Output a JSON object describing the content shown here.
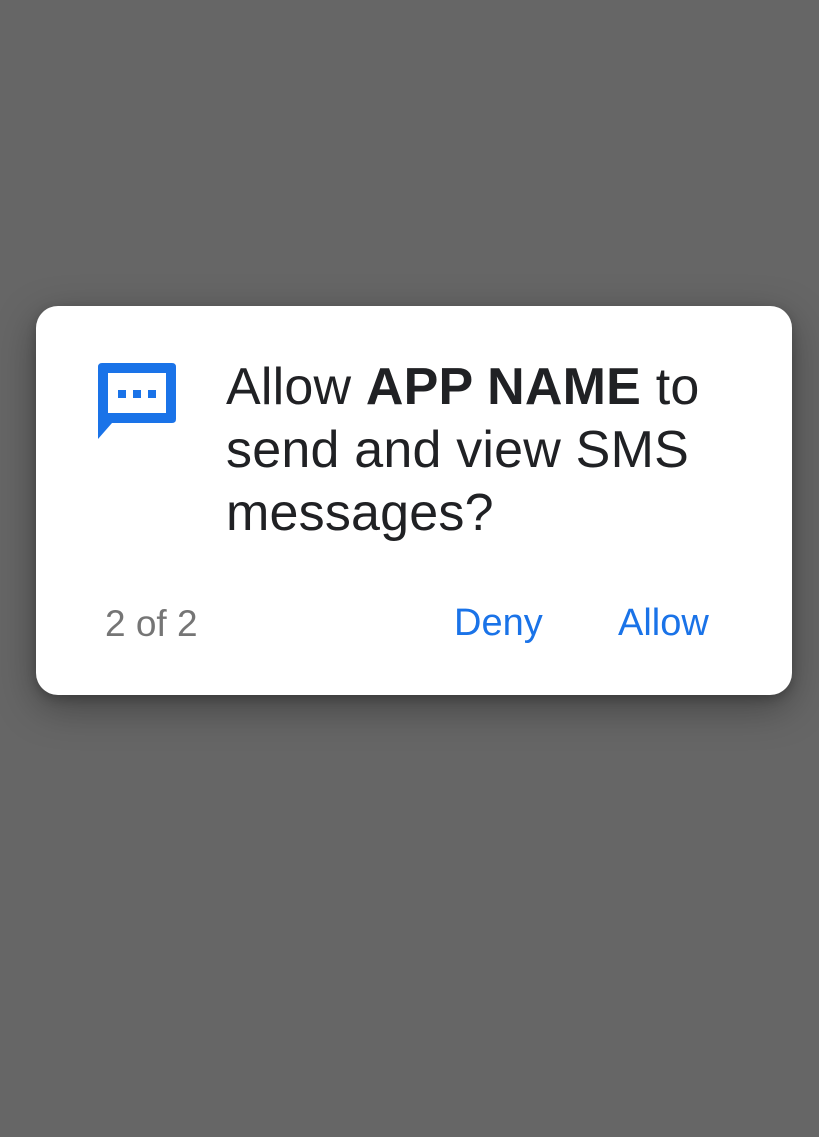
{
  "dialog": {
    "icon": "sms-message-icon",
    "message_prefix": "Allow ",
    "app_name": "APP NAME",
    "message_suffix": " to send and view SMS messages?",
    "counter": "2 of 2",
    "deny_label": "Deny",
    "allow_label": "Allow"
  },
  "colors": {
    "scrim": "#666666",
    "accent": "#1a73e8",
    "text": "#202124",
    "secondary_text": "#757575"
  }
}
